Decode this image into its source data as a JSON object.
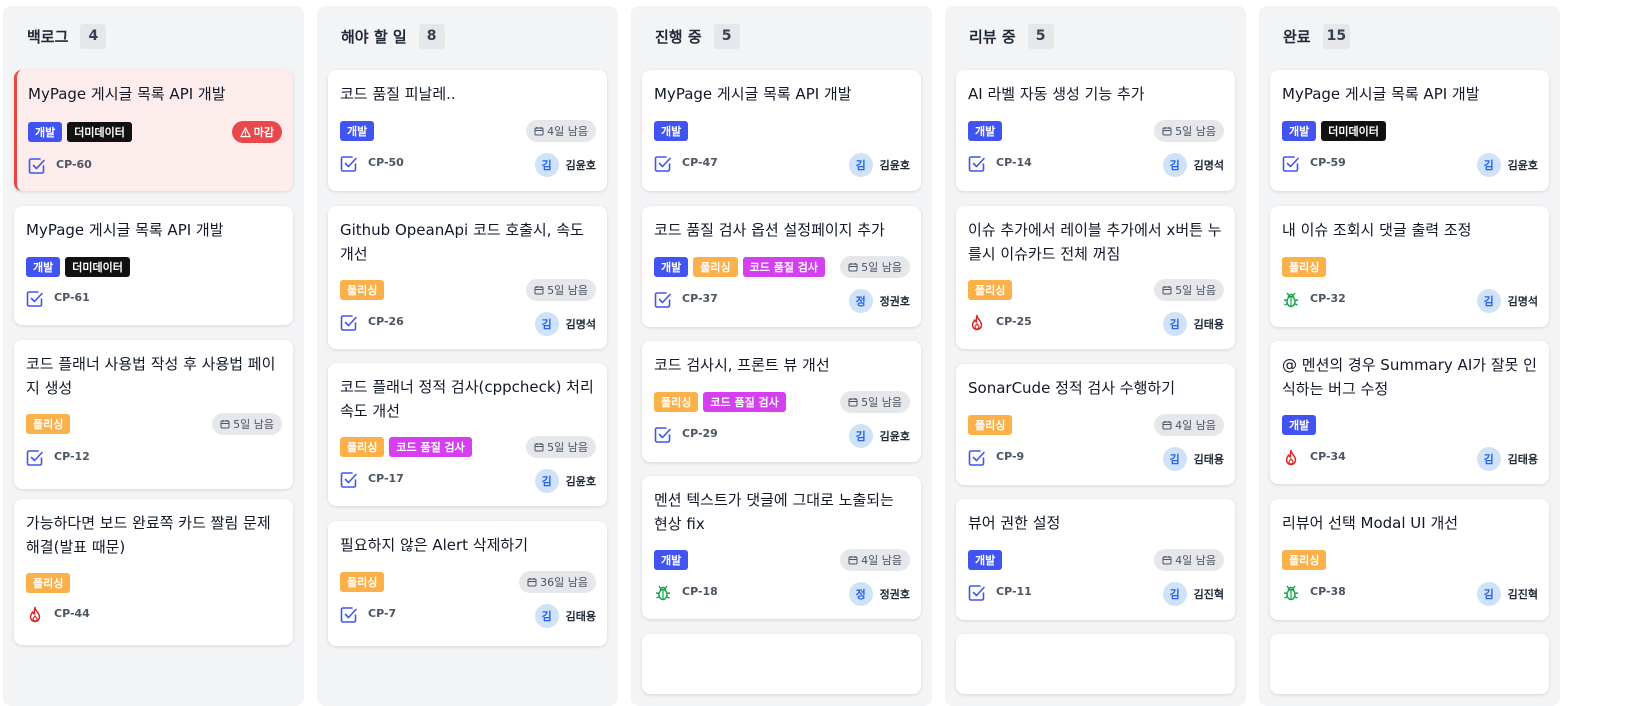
{
  "icons": {
    "checkbox": "task-checkbox-icon",
    "bug": "bug-icon",
    "fire": "fire-icon",
    "calendar": "calendar-icon",
    "warning": "warning-icon"
  },
  "colors": {
    "accent": "#4154f1",
    "overdue": "#e8484b",
    "polish": "#fbb04a",
    "quality": "#d43ff0",
    "dummy": "#111111"
  },
  "columns": [
    {
      "title": "백로그",
      "count": "4",
      "cards": [
        {
          "title": "MyPage 게시글 목록 API 개발",
          "tags": [
            "개발",
            "더미데이터"
          ],
          "due": "마감",
          "key": "CP-60",
          "assignee": ""
        },
        {
          "title": "MyPage 게시글 목록 API 개발",
          "tags": [
            "개발",
            "더미데이터"
          ],
          "due": "",
          "key": "CP-61",
          "assignee": ""
        },
        {
          "title": "코드 플래너 사용법 작성 후 사용법 페이지 생성",
          "tags": [
            "폴리싱"
          ],
          "due": "5일 남음",
          "key": "CP-12",
          "assignee": ""
        },
        {
          "title": "가능하다면 보드 완료쪽 카드 짤림 문제 해결(발표 때문)",
          "tags": [
            "폴리싱"
          ],
          "due": "",
          "key": "CP-44",
          "assignee": ""
        }
      ]
    },
    {
      "title": "해야 할 일",
      "count": "8",
      "cards": [
        {
          "title": "코드 품질 피날레..",
          "tags": [
            "개발"
          ],
          "due": "4일 남음",
          "key": "CP-50",
          "assignee": "김윤호",
          "avatar": "김"
        },
        {
          "title": "Github OpeanApi 코드 호출시, 속도 개선",
          "tags": [
            "폴리싱"
          ],
          "due": "5일 남음",
          "key": "CP-26",
          "assignee": "김명석",
          "avatar": "김"
        },
        {
          "title": "코드 플래너 정적 검사(cppcheck) 처리 속도 개선",
          "tags": [
            "폴리싱",
            "코드 품질 검사"
          ],
          "due": "5일 남음",
          "key": "CP-17",
          "assignee": "김윤호",
          "avatar": "김"
        },
        {
          "title": "필요하지 않은 Alert 삭제하기",
          "tags": [
            "폴리싱"
          ],
          "due": "36일 남음",
          "key": "CP-7",
          "assignee": "김태용",
          "avatar": "김"
        }
      ]
    },
    {
      "title": "진행 중",
      "count": "5",
      "cards": [
        {
          "title": "MyPage 게시글 목록 API 개발",
          "tags": [
            "개발"
          ],
          "due": "",
          "key": "CP-47",
          "assignee": "김윤호",
          "avatar": "김"
        },
        {
          "title": "코드 품질 검사 옵션 설정페이지 추가",
          "tags": [
            "개발",
            "폴리싱",
            "코드 품질 검사"
          ],
          "due": "5일 남음",
          "key": "CP-37",
          "assignee": "정권호",
          "avatar": "정"
        },
        {
          "title": "코드 검사시, 프론트 뷰 개선",
          "tags": [
            "폴리싱",
            "코드 품질 검사"
          ],
          "due": "5일 남음",
          "key": "CP-29",
          "assignee": "김윤호",
          "avatar": "김"
        },
        {
          "title": "멘션 텍스트가 댓글에 그대로 노출되는 현상 fix",
          "tags": [
            "개발"
          ],
          "due": "4일 남음",
          "key": "CP-18",
          "assignee": "정권호",
          "avatar": "정"
        }
      ]
    },
    {
      "title": "리뷰 중",
      "count": "5",
      "cards": [
        {
          "title": "AI 라벨 자동 생성 기능 추가",
          "tags": [
            "개발"
          ],
          "due": "5일 남음",
          "key": "CP-14",
          "assignee": "김명석",
          "avatar": "김"
        },
        {
          "title": "이슈 추가에서 레이블 추가에서 x버튼 누를시 이슈카드 전체 꺼짐",
          "tags": [
            "폴리싱"
          ],
          "due": "5일 남음",
          "key": "CP-25",
          "assignee": "김태용",
          "avatar": "김"
        },
        {
          "title": "SonarCude 정적 검사 수행하기",
          "tags": [
            "폴리싱"
          ],
          "due": "4일 남음",
          "key": "CP-9",
          "assignee": "김태용",
          "avatar": "김"
        },
        {
          "title": "뷰어 권한 설정",
          "tags": [
            "개발"
          ],
          "due": "4일 남음",
          "key": "CP-11",
          "assignee": "김진혁",
          "avatar": "김"
        }
      ]
    },
    {
      "title": "완료",
      "count": "15",
      "cards": [
        {
          "title": "MyPage 게시글 목록 API 개발",
          "tags": [
            "개발",
            "더미데이터"
          ],
          "due": "",
          "key": "CP-59",
          "assignee": "김윤호",
          "avatar": "김"
        },
        {
          "title": "내 이슈 조회시 댓글 출력 조정",
          "tags": [
            "폴리싱"
          ],
          "due": "",
          "key": "CP-32",
          "assignee": "김명석",
          "avatar": "김"
        },
        {
          "title": "@ 멘션의 경우 Summary AI가 잘못 인식하는 버그 수정",
          "tags": [
            "개발"
          ],
          "due": "",
          "key": "CP-34",
          "assignee": "김태용",
          "avatar": "김"
        },
        {
          "title": "리뷰어 선택 Modal UI 개선",
          "tags": [
            "폴리싱"
          ],
          "due": "",
          "key": "CP-38",
          "assignee": "김진혁",
          "avatar": "김"
        }
      ]
    }
  ]
}
